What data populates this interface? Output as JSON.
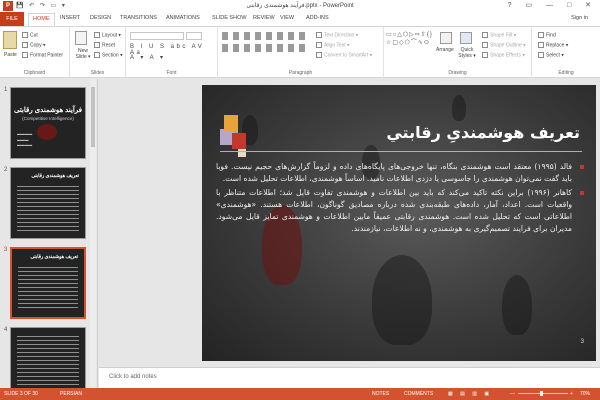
{
  "window": {
    "app_icon": "P",
    "title": "فرآیند هوشمندی رقابتی.pptx - PowerPoint",
    "quick_access": "💾 ↶ ↷ ▭ ▾",
    "controls": "? ▭ — □ ✕"
  },
  "tabs": {
    "file": "FILE",
    "home": "HOME",
    "insert": "INSERT",
    "design": "DESIGN",
    "transitions": "TRANSITIONS",
    "animations": "ANIMATIONS",
    "slideshow": "SLIDE SHOW",
    "review": "REVIEW",
    "view": "VIEW",
    "addins": "ADD-INS",
    "signin": "Sign in"
  },
  "ribbon": {
    "clipboard": {
      "paste": "Paste",
      "cut": "Cut",
      "copy": "Copy ▾",
      "format_painter": "Format Painter",
      "group": "Clipboard"
    },
    "slides": {
      "new_slide": "New Slide ▾",
      "layout": "Layout ▾",
      "reset": "Reset",
      "section": "Section ▾",
      "group": "Slides"
    },
    "font": {
      "format_row1": "B I U S abc AV Aa",
      "format_row2": "A ▾  A ▾",
      "group": "Font"
    },
    "paragraph": {
      "text_direction": "Text Direction ▾",
      "align_text": "Align Text ▾",
      "smartart": "Convert to SmartArt ▾",
      "group": "Paragraph"
    },
    "drawing": {
      "shapes_glyphs": "▭○△⬡▷⇨⇧{}☆▢◇⬠⌒∿⬭",
      "arrange": "Arrange",
      "quick_styles": "Quick Styles ▾",
      "shape_fill": "Shape Fill ▾",
      "shape_outline": "Shape Outline ▾",
      "shape_effects": "Shape Effects ▾",
      "group": "Drawing"
    },
    "editing": {
      "find": "Find",
      "replace": "Replace ▾",
      "select": "Select ▾",
      "group": "Editing"
    }
  },
  "thumbnails": [
    {
      "num": "1",
      "title": "فرآیند هوشمندی رقابتی",
      "subtitle": "(Competitive Intelligence)"
    },
    {
      "num": "2",
      "title": "تعریف هوشمندی رقابتی"
    },
    {
      "num": "3",
      "title": "تعریف هوشمندی رقابتی"
    },
    {
      "num": "4",
      "title": ""
    }
  ],
  "slide": {
    "title": "تعریف هوشمندیِ رقابتي",
    "paragraphs": [
      "فالد (۱۹۹۵) معتقد است هوشمندی بنگاه، تنها خروجی‌های پایگاه‌های داده و لزوماً گزارش‌های حجیم نیست. فوبا باید گفت نمی‌توان هوشمندی را جاسوسی یا دزدی اطلاعات نامید. اساساً هوشمندی، اطلاعات تحلیل شده است.",
      "کاهانر (۱۹۹۶) براین نکته تاکید می‌کند که باید بین اطلاعات و هوشمندی تفاوت قایل شد؛ اطلاعات متناظر با واقعیات است. اعداد، آمار، داده‌های طبقه‌بندی شده درباره مصادیق گوناگون، اطلاعات هستند. «هوشمندی» اطلاعاتی است که تحلیل شده است. هوشمندی رقابتی عمیقاً مابین اطلاعات و هوشمندی تمایز قایل می‌شود. مدیران برای فرایند تصمیم‌گیری به هوشمندی، و نه اطلاعات، نیازمندند."
    ],
    "number": "3"
  },
  "notes_placeholder": "Click to add notes",
  "status": {
    "slide_info": "SLIDE 3 OF 30",
    "language": "PERSIAN",
    "notes": "NOTES",
    "comments": "COMMENTS",
    "view_icons": "▦ ▤ ▥ ▣",
    "zoom": "70%",
    "zoom_minus": "—",
    "zoom_plus": "+"
  }
}
